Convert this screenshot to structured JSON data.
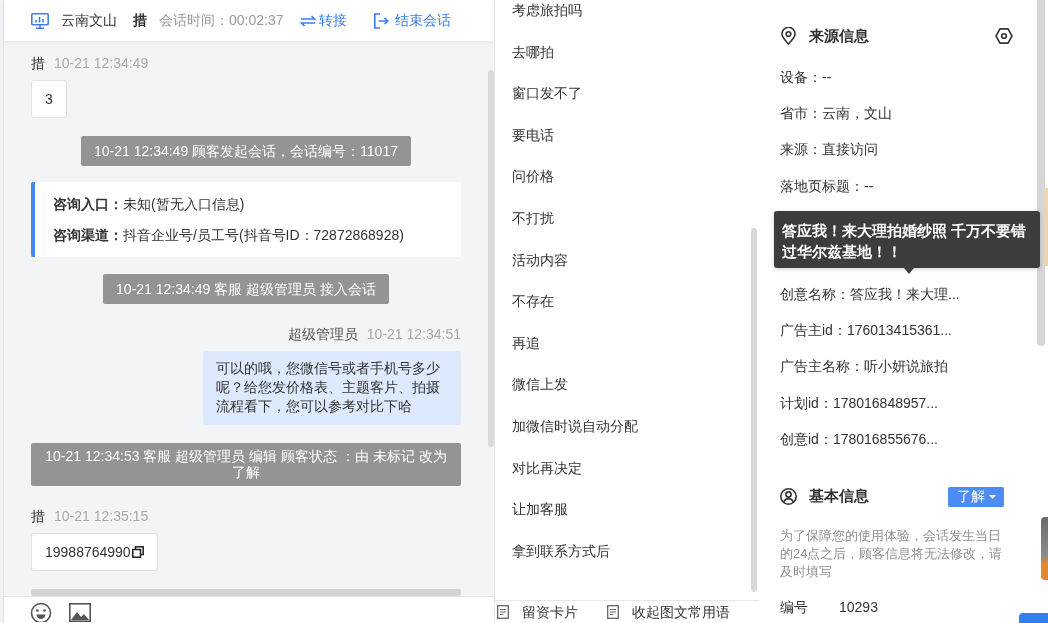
{
  "chat_header": {
    "location": "云南文山",
    "customer": "措",
    "session_time": "会话时间：00:02:37",
    "actions": [
      {
        "kind": "transfer",
        "label": "转接"
      },
      {
        "kind": "end",
        "label": "结束会话"
      }
    ]
  },
  "messages": [
    {
      "kind": "customer",
      "sender": "措",
      "time": "10-21 12:34:49",
      "text": "3"
    },
    {
      "kind": "system",
      "text": "10-21 12:34:49 顾客发起会话，会话编号：11017"
    },
    {
      "kind": "info",
      "lines": [
        {
          "label": "咨询入口：",
          "value": "未知(暂无入口信息)"
        },
        {
          "label": "咨询渠道：",
          "value": "抖音企业号/员工号(抖音号ID：72872868928)"
        }
      ]
    },
    {
      "kind": "system",
      "text": "10-21 12:34:49 客服 超级管理员 接入会话"
    },
    {
      "kind": "agent",
      "sender": "超级管理员",
      "time": "10-21 12:34:51",
      "text": "可以的哦，您微信号或者手机号多少呢？给您发价格表、主题客片、拍摄流程看下，您可以参考对比下哈"
    },
    {
      "kind": "system",
      "text": "10-21 12:34:53 客服 超级管理员 编辑 顾客状态 ：由 未标记 改为了解"
    },
    {
      "kind": "customer",
      "sender": "措",
      "time": "10-21 12:35:15",
      "text": "19988764990",
      "copyable": true
    },
    {
      "kind": "cut_off"
    }
  ],
  "quick_replies": {
    "items": [
      "考虑旅拍吗",
      "去哪拍",
      "窗口发不了",
      "要电话",
      "问价格",
      "不打扰",
      "活动内容",
      "不存在",
      "再追",
      "微信上发",
      "加微信时说自动分配",
      "对比再决定",
      "让加客服",
      "拿到联系方式后"
    ],
    "footer": [
      "留资卡片",
      "收起图文常用语"
    ]
  },
  "source_info": {
    "title": "来源信息",
    "items": [
      {
        "kind": "row",
        "text": "设备：--"
      },
      {
        "kind": "row",
        "text": "省市：云南，文山"
      },
      {
        "kind": "row",
        "text": "来源：直接访问"
      },
      {
        "kind": "row",
        "text": "落地页标题：--"
      },
      {
        "kind": "tooltip",
        "text": "答应我！来大理拍婚纱照 千万不要错过华尔兹基地！！"
      },
      {
        "kind": "row",
        "text": "创意名称：答应我！来大理..."
      },
      {
        "kind": "row",
        "text": "广告主id：176013415361..."
      },
      {
        "kind": "row",
        "text": "广告主名称：听小妍说旅拍"
      },
      {
        "kind": "row",
        "text": "计划id：178016848957..."
      },
      {
        "kind": "row",
        "text": "创意id：178016855676..."
      }
    ]
  },
  "basic_info": {
    "title": "基本信息",
    "status": "了解",
    "notice": "为了保障您的使用体验，会话发生当日的24点之后，顾客信息将无法修改，请及时填写",
    "fields": [
      {
        "label": "编号",
        "value": "10293"
      }
    ]
  }
}
